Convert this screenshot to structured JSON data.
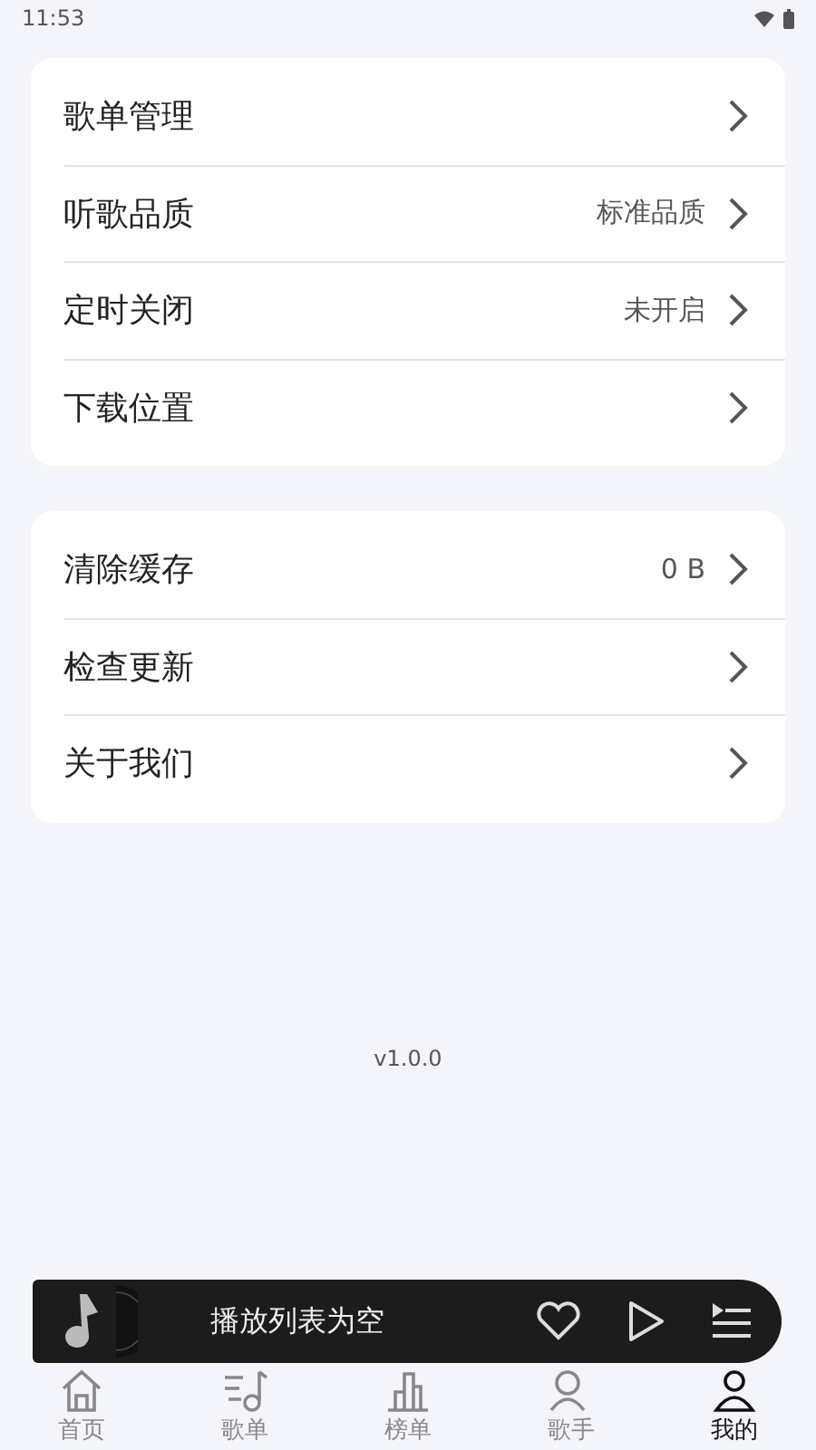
{
  "status_bar": {
    "time": "11:53"
  },
  "settings_groups": [
    {
      "items": [
        {
          "label": "歌单管理"
        },
        {
          "label": "听歌品质",
          "value": "标准品质"
        },
        {
          "label": "定时关闭",
          "value": "未开启"
        },
        {
          "label": "下载位置"
        }
      ]
    },
    {
      "items": [
        {
          "label": "清除缓存",
          "value": "0 B"
        },
        {
          "label": "检查更新"
        },
        {
          "label": "关于我们"
        }
      ]
    }
  ],
  "version": "v1.0.0",
  "player": {
    "title": "播放列表为空"
  },
  "bottom_nav": [
    {
      "label": "首页",
      "kind": "home",
      "selected": false
    },
    {
      "label": "歌单",
      "kind": "playlist",
      "selected": false
    },
    {
      "label": "榜单",
      "kind": "chart",
      "selected": false
    },
    {
      "label": "歌手",
      "kind": "singer",
      "selected": false
    },
    {
      "label": "我的",
      "kind": "me",
      "selected": true
    }
  ]
}
